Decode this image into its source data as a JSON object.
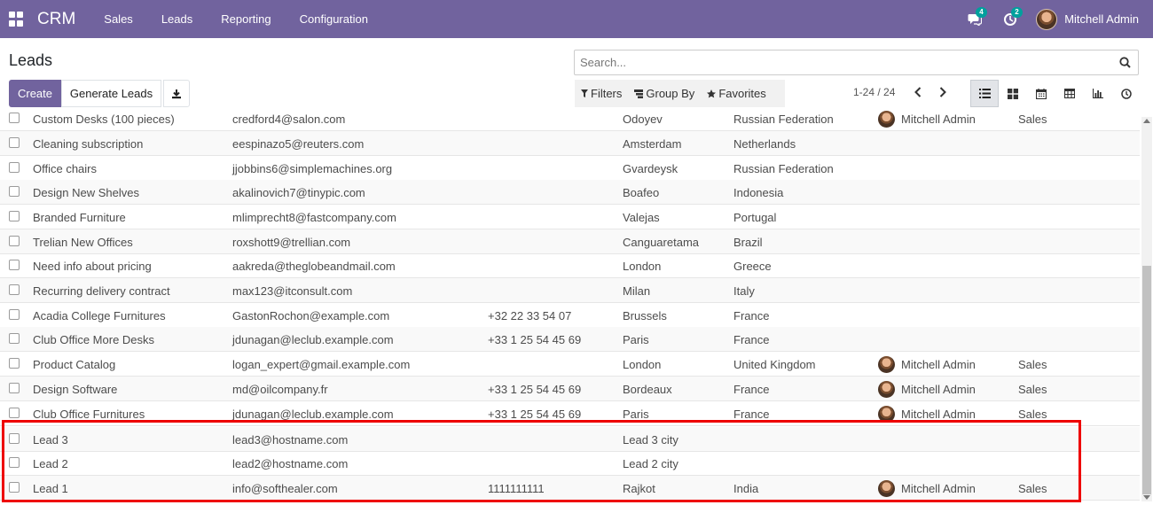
{
  "navbar": {
    "brand": "CRM",
    "menu": [
      "Sales",
      "Leads",
      "Reporting",
      "Configuration"
    ],
    "messages_badge": "4",
    "activities_badge": "2",
    "user_name": "Mitchell Admin"
  },
  "control_panel": {
    "title": "Leads",
    "search_placeholder": "Search...",
    "create_label": "Create",
    "generate_label": "Generate Leads",
    "filters_label": "Filters",
    "group_by_label": "Group By",
    "favorites_label": "Favorites",
    "pager": "1-24 / 24"
  },
  "rows": [
    {
      "name": "Custom Desks (100 pieces)",
      "email": "credford4@salon.com",
      "phone": "",
      "city": "Odoyev",
      "country": "Russian Federation",
      "salesperson": "Mitchell Admin",
      "team": "Sales"
    },
    {
      "name": "Cleaning subscription",
      "email": "eespinazo5@reuters.com",
      "phone": "",
      "city": "Amsterdam",
      "country": "Netherlands",
      "salesperson": "",
      "team": ""
    },
    {
      "name": "Office chairs",
      "email": "jjobbins6@simplemachines.org",
      "phone": "",
      "city": "Gvardeysk",
      "country": "Russian Federation",
      "salesperson": "",
      "team": ""
    },
    {
      "name": "Design New Shelves",
      "email": "akalinovich7@tinypic.com",
      "phone": "",
      "city": "Boafeo",
      "country": "Indonesia",
      "salesperson": "",
      "team": ""
    },
    {
      "name": "Branded Furniture",
      "email": "mlimprecht8@fastcompany.com",
      "phone": "",
      "city": "Valejas",
      "country": "Portugal",
      "salesperson": "",
      "team": ""
    },
    {
      "name": "Trelian New Offices",
      "email": "roxshott9@trellian.com",
      "phone": "",
      "city": "Canguaretama",
      "country": "Brazil",
      "salesperson": "",
      "team": ""
    },
    {
      "name": "Need info about pricing",
      "email": "aakreda@theglobeandmail.com",
      "phone": "",
      "city": "London",
      "country": "Greece",
      "salesperson": "",
      "team": ""
    },
    {
      "name": "Recurring delivery contract",
      "email": "max123@itconsult.com",
      "phone": "",
      "city": "Milan",
      "country": "Italy",
      "salesperson": "",
      "team": ""
    },
    {
      "name": "Acadia College Furnitures",
      "email": "GastonRochon@example.com",
      "phone": "+32 22 33 54 07",
      "city": "Brussels",
      "country": "France",
      "salesperson": "",
      "team": ""
    },
    {
      "name": "Club Office More Desks",
      "email": "jdunagan@leclub.example.com",
      "phone": "+33 1 25 54 45 69",
      "city": "Paris",
      "country": "France",
      "salesperson": "",
      "team": ""
    },
    {
      "name": "Product Catalog",
      "email": "logan_expert@gmail.example.com",
      "phone": "",
      "city": "London",
      "country": "United Kingdom",
      "salesperson": "Mitchell Admin",
      "team": "Sales"
    },
    {
      "name": "Design Software",
      "email": "md@oilcompany.fr",
      "phone": "+33 1 25 54 45 69",
      "city": "Bordeaux",
      "country": "France",
      "salesperson": "Mitchell Admin",
      "team": "Sales"
    },
    {
      "name": "Club Office Furnitures",
      "email": "jdunagan@leclub.example.com",
      "phone": "+33 1 25 54 45 69",
      "city": "Paris",
      "country": "France",
      "salesperson": "Mitchell Admin",
      "team": "Sales"
    },
    {
      "name": "Lead 3",
      "email": "lead3@hostname.com",
      "phone": "",
      "city": "Lead 3 city",
      "country": "",
      "salesperson": "",
      "team": ""
    },
    {
      "name": "Lead 2",
      "email": "lead2@hostname.com",
      "phone": "",
      "city": "Lead 2 city",
      "country": "",
      "salesperson": "",
      "team": ""
    },
    {
      "name": "Lead 1",
      "email": "info@softhealer.com",
      "phone": "1111111111",
      "city": "Rajkot",
      "country": "India",
      "salesperson": "Mitchell Admin",
      "team": "Sales"
    }
  ],
  "colors": {
    "brand": "#71639e",
    "badge": "#00a09d",
    "highlight": "#ee0000"
  }
}
